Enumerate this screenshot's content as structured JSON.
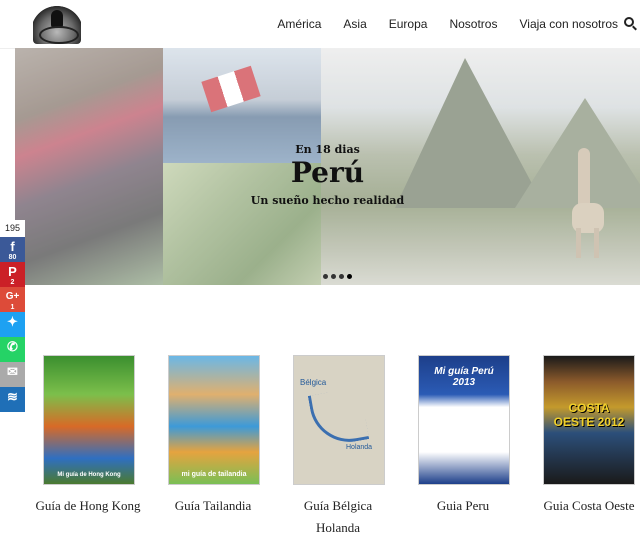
{
  "header": {
    "nav": [
      {
        "label": "América"
      },
      {
        "label": "Asia"
      },
      {
        "label": "Europa"
      },
      {
        "label": "Nosotros"
      },
      {
        "label": "Viaja con nosotros"
      }
    ]
  },
  "hero": {
    "kicker": "En 18 dias",
    "title": "Perú",
    "subtitle": "Un sueño hecho realidad",
    "slide_count": 4,
    "active_slide": 4
  },
  "share": {
    "total": "195",
    "facebook": {
      "icon": "facebook-icon",
      "count": "80"
    },
    "pinterest": {
      "icon": "pinterest-icon",
      "count": "2"
    },
    "googleplus": {
      "icon": "google-plus-icon",
      "label": "G+",
      "count": "1"
    },
    "twitter": {
      "icon": "twitter-icon"
    },
    "whatsapp": {
      "icon": "whatsapp-icon"
    },
    "email": {
      "icon": "email-icon"
    },
    "sumo": {
      "icon": "sumo-icon"
    }
  },
  "guides": [
    {
      "label": "Guía de Hong Kong",
      "cover_text": "Mi guía de Hong Kong"
    },
    {
      "label": "Guía Tailandia",
      "cover_text": "mi guía de tailandia"
    },
    {
      "label": "Guía Bélgica Holanda",
      "cover_top": "Bélgica",
      "cover_bottom": "Holanda"
    },
    {
      "label": "Guia Peru",
      "cover_text": "Mi guía Perú 2013"
    },
    {
      "label": "Guia Costa Oeste",
      "cover_text": "COSTA OESTE 2012"
    }
  ]
}
